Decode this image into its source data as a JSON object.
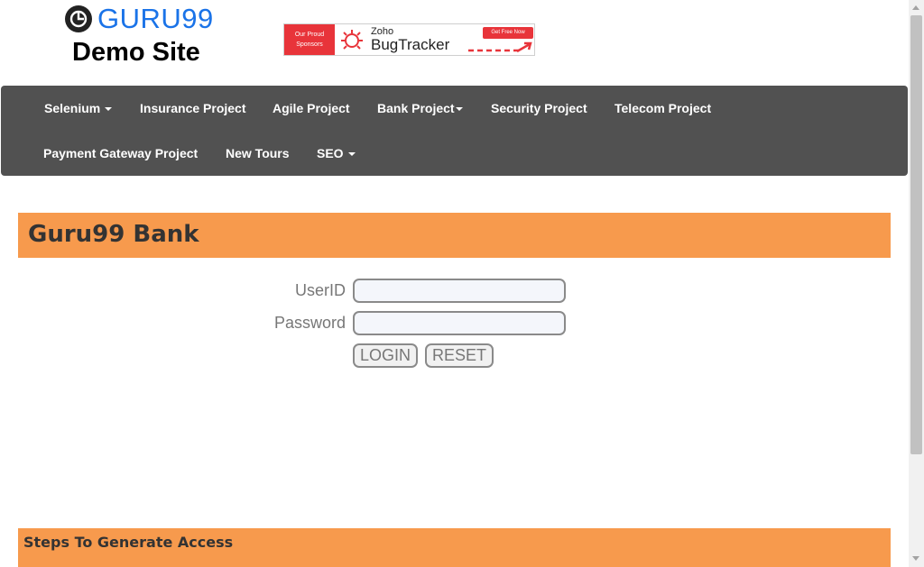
{
  "logo": {
    "brand": "GURU99",
    "subtitle": "Demo Site",
    "icon": "guru99-logo-icon"
  },
  "banner": {
    "left_line1": "Our Proud",
    "left_line2": "Sponsors",
    "brand_small": "Zoho",
    "product": "BugTracker",
    "cta": "Get Free Now",
    "icon": "bug-icon"
  },
  "nav": {
    "row1": [
      {
        "label": "Selenium",
        "dropdown": true
      },
      {
        "label": "Insurance Project",
        "dropdown": false
      },
      {
        "label": "Agile Project",
        "dropdown": false
      },
      {
        "label": "Bank Project",
        "dropdown": true
      },
      {
        "label": "Security Project",
        "dropdown": false
      },
      {
        "label": "Telecom Project",
        "dropdown": false
      }
    ],
    "row2": [
      {
        "label": "Payment Gateway Project",
        "dropdown": false
      },
      {
        "label": "New Tours",
        "dropdown": false
      },
      {
        "label": "SEO",
        "dropdown": true
      }
    ]
  },
  "bank": {
    "title": "Guru99 Bank"
  },
  "login": {
    "userid_label": "UserID",
    "userid_value": "",
    "password_label": "Password",
    "password_value": "",
    "login_button": "LOGIN",
    "reset_button": "RESET"
  },
  "steps": {
    "title": "Steps To Generate Access"
  },
  "colors": {
    "accent": "#f79a4d",
    "nav_bg": "#515151",
    "brand_blue": "#1a73e8",
    "sponsor_red": "#e8343a"
  }
}
